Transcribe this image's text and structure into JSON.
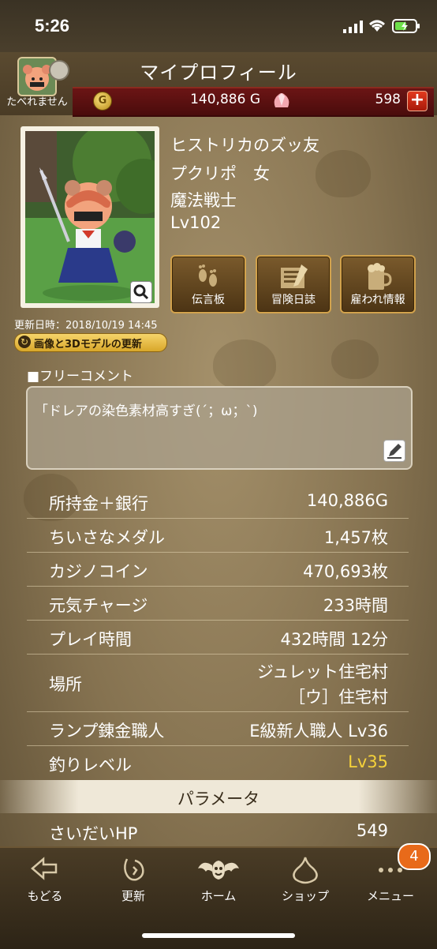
{
  "status_bar": {
    "time": "5:26"
  },
  "header": {
    "title": "マイプロフィール",
    "username": "たべれません",
    "gold_value": "140,886 G",
    "gold_icon_letter": "G",
    "gem_value": "598",
    "plus_label": "+"
  },
  "profile": {
    "team": "ヒストリカのズッ友",
    "race_gender": "プクリポ　女",
    "job": "魔法戦士",
    "level": "Lv102",
    "updated_at": "更新日時：2018/10/19 14:45",
    "refresh_label": "画像と3Dモデルの更新"
  },
  "actions": [
    {
      "label": "伝言板",
      "icon": "footprints-icon"
    },
    {
      "label": "冒険日誌",
      "icon": "journal-icon"
    },
    {
      "label": "雇われ情報",
      "icon": "beer-mug-icon"
    }
  ],
  "comment": {
    "heading": "■フリーコメント",
    "text": "「ドレアの染色素材高すぎ(´；ω；`)"
  },
  "stats": [
    {
      "label": "所持金＋銀行",
      "value": "140,886G"
    },
    {
      "label": "ちいさなメダル",
      "value": "1,457枚"
    },
    {
      "label": "カジノコイン",
      "value": "470,693枚"
    },
    {
      "label": "元気チャージ",
      "value": "233時間"
    },
    {
      "label": "プレイ時間",
      "value": "432時間 12分"
    },
    {
      "label": "場所",
      "value": "ジュレット住宅村",
      "value2": "［ウ］住宅村"
    },
    {
      "label": "ランプ錬金職人",
      "value": "E級新人職人 Lv36"
    },
    {
      "label": "釣りレベル",
      "value": "Lv35",
      "color": "#f5d23a"
    }
  ],
  "section": {
    "title": "パラメータ"
  },
  "params": [
    {
      "label": "さいだいHP",
      "value": "549"
    }
  ],
  "nav": {
    "items": [
      {
        "label": "もどる",
        "icon": "back-arrow-icon"
      },
      {
        "label": "更新",
        "icon": "refresh-icon"
      },
      {
        "label": "ホーム",
        "icon": "bat-monster-icon"
      },
      {
        "label": "ショップ",
        "icon": "slime-icon"
      },
      {
        "label": "メニュー",
        "icon": "more-dots-icon"
      }
    ],
    "menu_badge": "4"
  }
}
